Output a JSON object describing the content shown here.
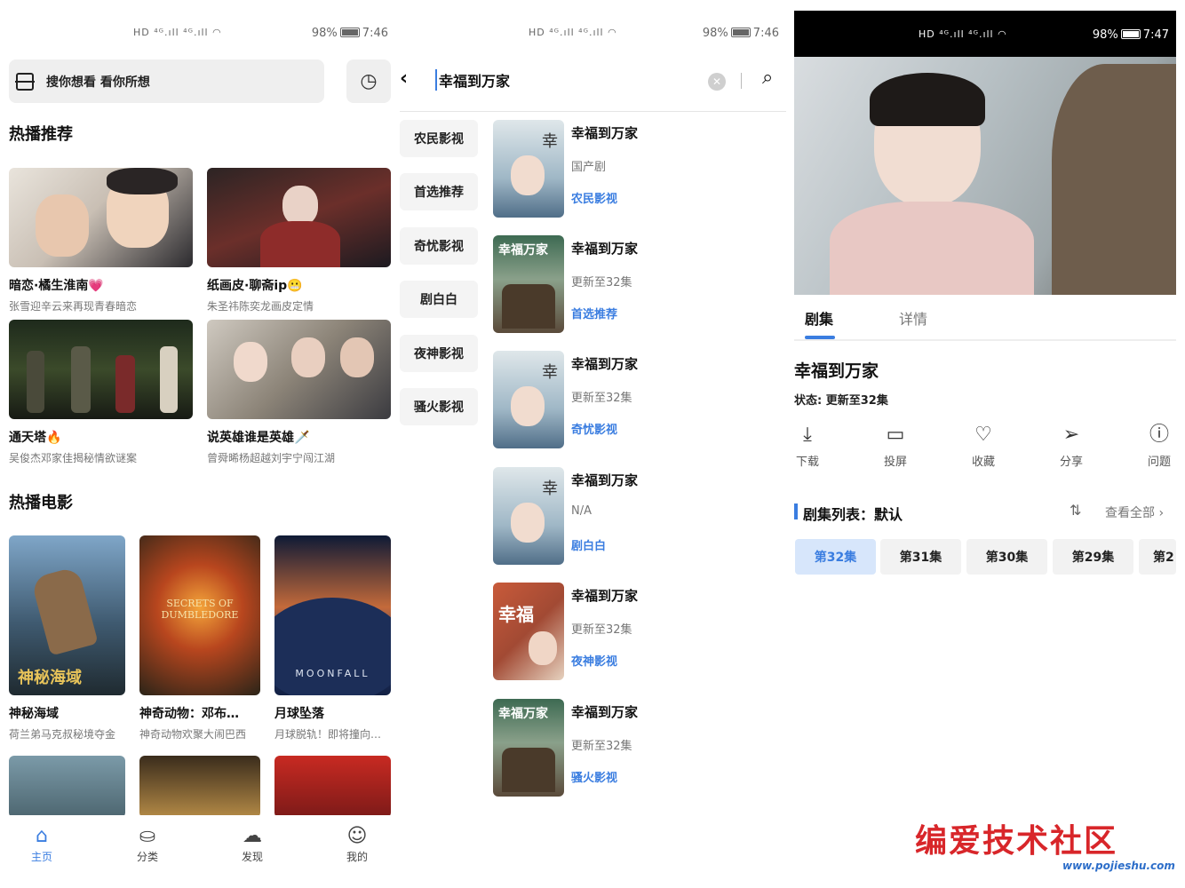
{
  "status_left": {
    "time": "7:46",
    "battery": "98%"
  },
  "status_mid": {
    "time": "7:46",
    "battery": "98%"
  },
  "status_right": {
    "time": "7:47",
    "battery": "98%"
  },
  "home": {
    "search_placeholder": "搜你想看 看你所想",
    "section_hot": "热播推荐",
    "section_movies": "热播电影",
    "hot": [
      {
        "title": "暗恋·橘生淮南💗",
        "subtitle": "张雪迎辛云来再现青春暗恋"
      },
      {
        "title": "纸画皮·聊斋ip😬",
        "subtitle": "朱圣祎陈奕龙画皮定情"
      },
      {
        "title": "通天塔🔥",
        "subtitle": "吴俊杰邓家佳揭秘情欲谜案"
      },
      {
        "title": "说英雄谁是英雄🗡️",
        "subtitle": "曾舜晞杨超越刘宇宁闯江湖"
      }
    ],
    "movies": [
      {
        "title": "神秘海域",
        "subtitle": "荷兰弟马克叔秘境夺金"
      },
      {
        "title": "神奇动物：邓布…",
        "subtitle": "神奇动物欢聚大闹巴西"
      },
      {
        "title": "月球坠落",
        "subtitle": "月球脱轨！即将撞向…"
      }
    ],
    "tabs": [
      {
        "label": "主页",
        "icon": "home-icon"
      },
      {
        "label": "分类",
        "icon": "category-icon"
      },
      {
        "label": "发现",
        "icon": "discover-icon"
      },
      {
        "label": "我的",
        "icon": "profile-icon"
      }
    ]
  },
  "search": {
    "query": "幸福到万家",
    "sources": [
      "农民影视",
      "首选推荐",
      "奇忧影视",
      "剧白白",
      "夜神影视",
      "骚火影视"
    ],
    "results": [
      {
        "title": "幸福到万家",
        "status": "国产剧",
        "source": "农民影视"
      },
      {
        "title": "幸福到万家",
        "status": "更新至32集",
        "source": "首选推荐"
      },
      {
        "title": "幸福到万家",
        "status": "更新至32集",
        "source": "奇忧影视"
      },
      {
        "title": "幸福到万家",
        "status": "N/A",
        "source": "剧白白"
      },
      {
        "title": "幸福到万家",
        "status": "更新至32集",
        "source": "夜神影视"
      },
      {
        "title": "幸福到万家",
        "status": "更新至32集",
        "source": "骚火影视"
      }
    ]
  },
  "detail": {
    "tab_episodes": "剧集",
    "tab_info": "详情",
    "title": "幸福到万家",
    "state": "状态: 更新至32集",
    "actions": [
      {
        "label": "下载",
        "icon": "download-icon"
      },
      {
        "label": "投屏",
        "icon": "cast-icon"
      },
      {
        "label": "收藏",
        "icon": "heart-icon"
      },
      {
        "label": "分享",
        "icon": "share-icon"
      },
      {
        "label": "问题",
        "icon": "help-icon"
      }
    ],
    "episode_list_label": "剧集列表：默认",
    "view_all": "查看全部",
    "episodes": [
      "第32集",
      "第31集",
      "第30集",
      "第29集",
      "第2"
    ]
  },
  "watermark": {
    "text": "编爱技术社区",
    "url": "www.pojieshu.com"
  },
  "colors": {
    "accent": "#3a7de0",
    "watermark": "#d8262a"
  }
}
